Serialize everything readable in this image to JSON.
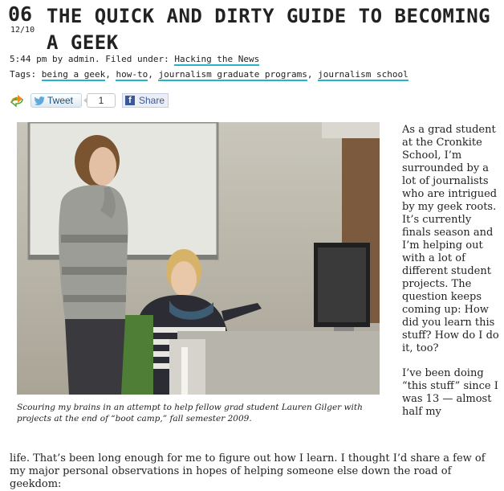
{
  "post": {
    "day": "06",
    "month_year": "12/10",
    "title": "THE QUICK AND DIRTY GUIDE TO BECOMING A GEEK",
    "time": "5:44 pm",
    "author": "admin",
    "byline_prefix": " by ",
    "byline_filed": ". Filed under: ",
    "category": "Hacking the News",
    "tags_label": "Tags: ",
    "tags": [
      "being a geek",
      "how-to",
      "journalism graduate programs",
      "journalism school"
    ],
    "tag_separator": ", "
  },
  "share": {
    "tweet_label": "Tweet",
    "tweet_count": "1",
    "facebook_label": "Share",
    "facebook_icon": "f"
  },
  "photo": {
    "caption": "Scouring my brains in an attempt to help fellow grad student Lauren Gilger with projects at the end of “boot camp,” fall semester 2009."
  },
  "article": {
    "side_paragraph_1": "As a grad student at the Cronkite School, I’m surrounded by a lot of journalists who are intrigued by my geek roots. It’s currently finals season and I’m helping out with a lot of different student projects. The question keeps coming up: How did you learn this stuff? How do I do it, too?",
    "side_paragraph_2_start": "I’ve been doing “this stuff” since I was 13 — almost half my",
    "paragraph_2_rest": "life. That’s been long enough for me to figure out how I learn. I thought I’d share a few of my major personal observations in hopes of helping someone else down the road of geekdom:"
  },
  "colors": {
    "link_underline": "#2ab3c7",
    "twitter_text": "#1b4f76",
    "facebook_blue": "#3b5998"
  }
}
